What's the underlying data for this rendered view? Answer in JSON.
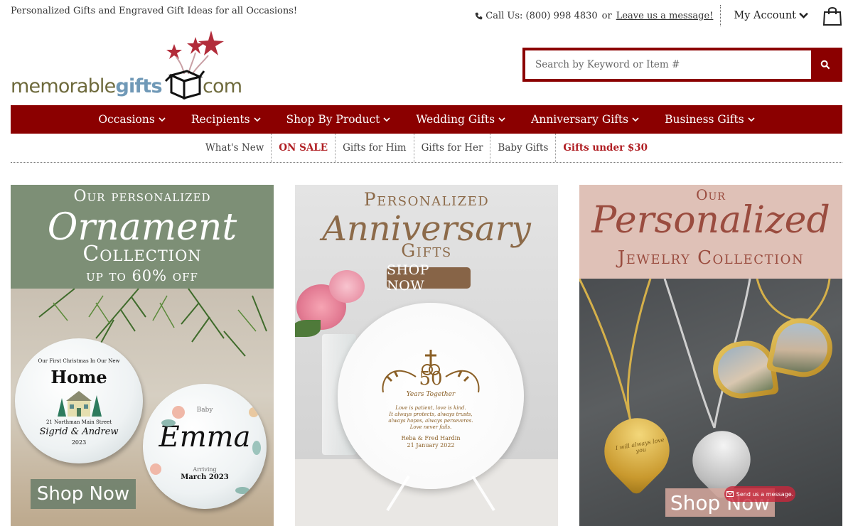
{
  "header": {
    "tagline": "Personalized Gifts and Engraved Gift Ideas for all Occasions!",
    "call_label": "Call Us: (800) 998 4830",
    "or": "or",
    "leave_message": "Leave us a message!",
    "account_label": "My Account"
  },
  "logo": {
    "part1": "memorable",
    "part2": "gifts",
    "part3": "com"
  },
  "search": {
    "placeholder": "Search by Keyword or Item #"
  },
  "main_nav": [
    {
      "label": "Occasions"
    },
    {
      "label": "Recipients"
    },
    {
      "label": "Shop By Product"
    },
    {
      "label": "Wedding Gifts"
    },
    {
      "label": "Anniversary Gifts"
    },
    {
      "label": "Business Gifts"
    }
  ],
  "sub_nav": [
    {
      "label": "What's New"
    },
    {
      "label": "ON SALE"
    },
    {
      "label": "Gifts for Him"
    },
    {
      "label": "Gifts for Her"
    },
    {
      "label": "Baby Gifts"
    },
    {
      "label": "Gifts under $30"
    }
  ],
  "banners": {
    "ornament": {
      "line1": "Our personalized",
      "line2": "Ornament",
      "line3": "Collection",
      "line4": "up to 60% off",
      "orn1_top": "Our First Christmas In Our New",
      "orn1_main": "Home",
      "orn1_addr": "21 Northman Main Street",
      "orn1_names": "Sigrid & Andrew",
      "orn1_year": "2023",
      "orn2_small": "Baby",
      "orn2_name": "Emma",
      "orn2_arr": "Arriving",
      "orn2_date": "March 2023",
      "cta": "Shop Now"
    },
    "anniversary": {
      "line1": "Personalized",
      "line2": "Anniversary",
      "line3": "Gifts",
      "cta": "SHOP NOW",
      "plate_num": "50",
      "plate_sub": "Years Together",
      "plate_verse": "Love is patient, love is kind.",
      "plate_verse2": "It always protects, always trusts,",
      "plate_verse3": "always hopes, always perseveres.",
      "plate_verse4": "Love never fails.",
      "plate_names": "Reba & Fred Hardin",
      "plate_date": "21 January 2022"
    },
    "jewelry": {
      "line1": "Our",
      "line2": "Personalized",
      "line3": "Jewelry Collection",
      "engrave": "I will always love you",
      "cta": "Shop Now",
      "send_message": "Send us a message."
    }
  },
  "colors": {
    "brand_red": "#8b0000",
    "sale_red": "#b01e23",
    "logo_olive": "#6e6a3c",
    "logo_blue": "#7099b7"
  },
  "icons": [
    "phone-icon",
    "chevron-down-icon",
    "shopping-bag-icon",
    "search-icon",
    "star-icon",
    "gift-box-icon"
  ]
}
